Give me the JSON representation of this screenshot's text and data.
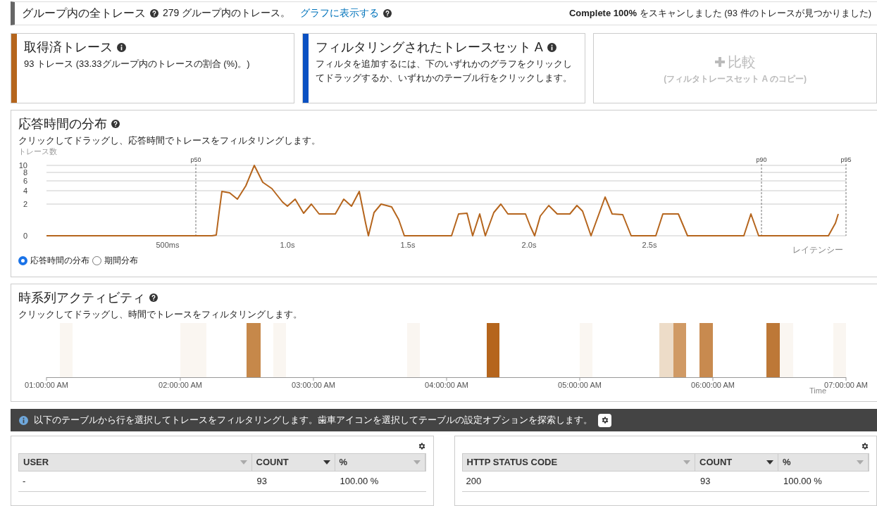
{
  "header": {
    "title": "グループ内の全トレース",
    "count_text": "279 グループ内のトレース。",
    "link": "グラフに表示する",
    "scan_bold": "Complete 100%",
    "scan_text": "をスキャンしました (93 件のトレースが見つかりました)"
  },
  "cards": [
    {
      "kind": "stat",
      "color": "#b5651d",
      "title": "取得済トレース",
      "body": "93 トレース (33.33グループ内のトレースの割合 (%)。)"
    },
    {
      "kind": "stat",
      "color": "#0a50c2",
      "title": "フィルタリングされたトレースセット A",
      "body": "フィルタを追加するには、下のいずれかのグラフをクリックしてドラッグするか、いずれかのテーブル行をクリックします。"
    },
    {
      "kind": "compare",
      "title": "比較",
      "body": "(フィルタトレースセット A のコピー)"
    }
  ],
  "latency": {
    "title": "応答時間の分布",
    "subtitle": "クリックしてドラッグし、応答時間でトレースをフィルタリングします。",
    "ylabel": "トレース数",
    "yticks": [
      "10",
      "8",
      "6",
      "4",
      "2",
      "0"
    ],
    "xticks": [
      "500ms",
      "1.0s",
      "1.5s",
      "2.0s",
      "2.5s"
    ],
    "markers": [
      "p50",
      "p90",
      "p95"
    ],
    "xlabel": "レイテンシー",
    "options": [
      {
        "label": "応答時間の分布",
        "selected": true
      },
      {
        "label": "期間分布",
        "selected": false
      }
    ]
  },
  "timeline": {
    "title": "時系列アクティビティ",
    "subtitle": "クリックしてドラッグし、時間でトレースをフィルタリングします。",
    "xticks": [
      "01:00:00 AM",
      "02:00:00 AM",
      "03:00:00 AM",
      "04:00:00 AM",
      "05:00:00 AM",
      "06:00:00 AM",
      "07:00:00 AM"
    ],
    "xlabel": "Time"
  },
  "info_bar": {
    "text": "以下のテーブルから行を選択してトレースをフィルタリングします。歯車アイコンを選択してテーブルの設定オプションを探索します。"
  },
  "tables": [
    {
      "columns": [
        {
          "label": "USER",
          "sorted": false
        },
        {
          "label": "COUNT",
          "sorted": true
        },
        {
          "label": "%",
          "sorted": false
        }
      ],
      "rows": [
        [
          "-",
          "93",
          "100.00 %"
        ]
      ]
    },
    {
      "columns": [
        {
          "label": "HTTP STATUS CODE",
          "sorted": false
        },
        {
          "label": "COUNT",
          "sorted": true
        },
        {
          "label": "%",
          "sorted": false
        }
      ],
      "rows": [
        [
          "200",
          "93",
          "100.00 %"
        ]
      ]
    }
  ]
}
